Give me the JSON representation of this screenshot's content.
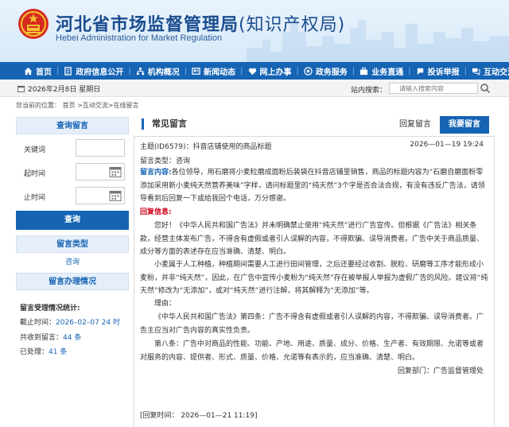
{
  "header": {
    "title_main": "河北省市场监督管理局",
    "title_sub": "(知识产权局)",
    "title_en": "Hebei Administration for Market Regulation"
  },
  "nav": [
    {
      "label": "首页",
      "icon": "home-icon"
    },
    {
      "label": "政府信息公开",
      "icon": "document-icon"
    },
    {
      "label": "机构概况",
      "icon": "org-icon"
    },
    {
      "label": "新闻动态",
      "icon": "news-icon"
    },
    {
      "label": "网上办事",
      "icon": "heart-icon"
    },
    {
      "label": "政务服务",
      "icon": "service-icon"
    },
    {
      "label": "业务直通",
      "icon": "business-icon"
    },
    {
      "label": "投诉举报",
      "icon": "complaint-icon"
    },
    {
      "label": "互动交流",
      "icon": "chat-icon"
    }
  ],
  "datebar": {
    "date": "2026年2月8日 星期日",
    "search_label": "站内搜索：",
    "search_placeholder": "请输入搜索内容"
  },
  "breadcrumb": "您当前的位置： 首页 >互动交流>在线留言",
  "left": {
    "query_title": "查询留言",
    "keyword_label": "关键词",
    "start_label": "起时间",
    "end_label": "止时间",
    "query_button": "查询",
    "type_title": "留言类型",
    "type_item": "咨询",
    "handle_title": "留言办理情况",
    "stats_title": "留言受理情况统计:",
    "stats": [
      {
        "label": "截止时间：",
        "value": "2026–02–07 24 时"
      },
      {
        "label": "共收到留言：",
        "value": "44 条"
      },
      {
        "label": "已处理：",
        "value": "41 条"
      }
    ]
  },
  "main": {
    "tab_title": "常见留言",
    "tab_reply": "回复留言",
    "tab_ask": "我要留言",
    "topic": "主题(ID6579)：抖音店铺使用的商品标题",
    "topic_time": "2026—01—19  19:24",
    "msg_type": "留言类型：咨询",
    "content_label": "留言内容:",
    "content": "各位领导，用石磨将小麦粒磨成面粉后装袋在抖音店铺里销售，商品的标题内容为“石磨自磨面粉零添加采用新小麦纯天然营养美味”字样，请问标题里的“纯天然”3个字是否合法合规，有没有违反广告法，请领导看到后回复一下或给我回个电话，万分感谢。",
    "reply_label": "回复信息:",
    "reply_p1": "您好！《中华人民共和国广告法》并未明确禁止使用“纯天然”进行广告宣传。但根据《广告法》相关条款，经营主体发布广告，不得含有虚假或者引人误解的内容，不得欺骗、误导消费者。广告中关于商品质量、成分等方面的表述存在应当准确、清楚、明白。",
    "reply_p2": "小麦属于人工种植，种植期间需要人工进行田间管理，之后还要经过收割、脱粒、研磨等工序才能形成小麦粉，并非“纯天然”，因此，在广告中宣传小麦粉为“纯天然”存在被举报人举报为虚假广告的风险。建议将“纯天然”修改为“无添加”，或对“纯天然”进行注解，将其解释为“无添加”等。",
    "reason_label": "理由：",
    "reply_p3": "《中华人民共和国广告法》第四条：广告不得含有虚假或者引人误解的内容，不得欺骗、误导消费者。广告主应当对广告内容的真实性负责。",
    "reply_p4": "第八条：广告中对商品的性能、功能、产地、用途、质量、成分、价格、生产者、有效期限、允诺等或者对服务的内容、提供者、形式、质量、价格、允诺等有表示的，应当准确、清楚、明白。",
    "dept_label": "回复部门：",
    "dept": "广告监督管理处",
    "reply_time": "[回复时间：  2026—01—21 11:19]"
  },
  "colors": {
    "primary": "#1664b4",
    "red": "#d0021b",
    "nav_bg": "#1664b4"
  }
}
